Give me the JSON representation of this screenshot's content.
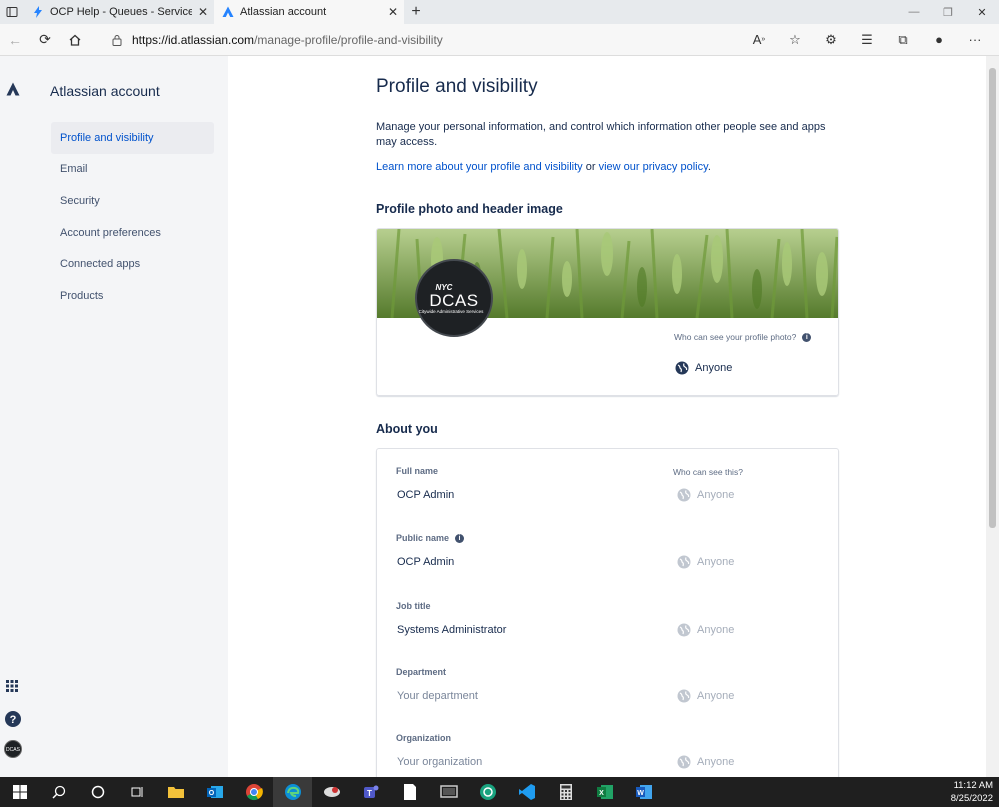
{
  "browser": {
    "tabs": [
      {
        "title": "OCP Help - Queues - Service pro",
        "active": false
      },
      {
        "title": "Atlassian account",
        "active": true
      }
    ],
    "url_host": "https://id.atlassian.com",
    "url_path": "/manage-profile/profile-and-visibility"
  },
  "sidebar": {
    "brand": "Atlassian account",
    "items": [
      {
        "label": "Profile and visibility",
        "active": true
      },
      {
        "label": "Email",
        "active": false
      },
      {
        "label": "Security",
        "active": false
      },
      {
        "label": "Account preferences",
        "active": false
      },
      {
        "label": "Connected apps",
        "active": false
      },
      {
        "label": "Products",
        "active": false
      }
    ]
  },
  "main": {
    "title": "Profile and visibility",
    "intro": "Manage your personal information, and control which information other people see and apps may access.",
    "learn_link": "Learn more about your profile and visibility",
    "learn_or": " or ",
    "privacy_link": "view our privacy policy",
    "learn_end": ".",
    "photo_section": "Profile photo and header image",
    "photo_who": "Who can see your profile photo?",
    "photo_visibility": "Anyone",
    "avatar_text": {
      "nyc": "NYC",
      "dcas": "DCAS",
      "sub": "Citywide Administrative Services"
    },
    "about_section": "About you",
    "who_col": "Who can see this?",
    "fields": [
      {
        "label": "Full name",
        "value": "OCP Admin",
        "placeholder": false,
        "visibility": "Anyone",
        "info": false
      },
      {
        "label": "Public name",
        "value": "OCP Admin",
        "placeholder": false,
        "visibility": "Anyone",
        "info": true
      },
      {
        "label": "Job title",
        "value": "Systems Administrator",
        "placeholder": false,
        "visibility": "Anyone",
        "info": false
      },
      {
        "label": "Department",
        "value": "Your department",
        "placeholder": true,
        "visibility": "Anyone",
        "info": false
      },
      {
        "label": "Organization",
        "value": "Your organization",
        "placeholder": true,
        "visibility": "Anyone",
        "info": false
      }
    ]
  },
  "taskbar": {
    "time": "11:12 AM",
    "date": "8/25/2022"
  },
  "colors": {
    "accent": "#0052cc",
    "sidebar_bg": "#f4f5f7",
    "text": "#172b4d",
    "taskbar": "#1f1f1f"
  }
}
